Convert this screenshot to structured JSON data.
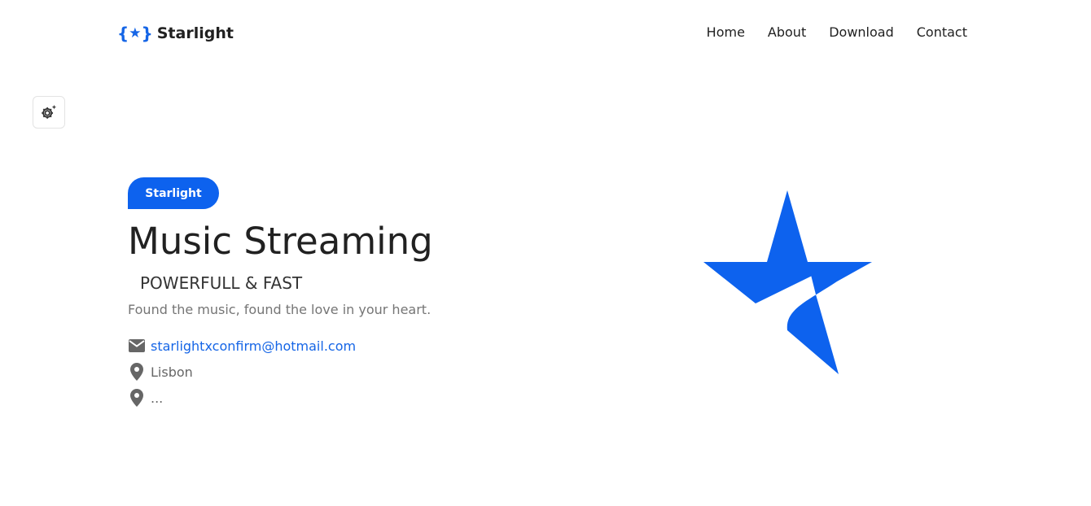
{
  "header": {
    "brand_icon_left": "{",
    "brand_icon_star": "★",
    "brand_icon_right": "}",
    "brand_name": "Starlight",
    "nav": [
      {
        "label": "Home"
      },
      {
        "label": "About"
      },
      {
        "label": "Download"
      },
      {
        "label": "Contact"
      }
    ]
  },
  "settings_button": {
    "icon": "gear-sparkle-icon"
  },
  "hero": {
    "badge": "Starlight",
    "title": "Music Streaming",
    "subtitle": "POWERFULL & FAST",
    "tagline": "Found the music, found the love in your heart.",
    "email": "starlightxconfirm@hotmail.com",
    "location": "Lisbon",
    "extra": "...",
    "logo_icon": "star-logo-icon"
  },
  "colors": {
    "accent": "#0d62ee",
    "text": "#212121",
    "muted": "#757575"
  }
}
